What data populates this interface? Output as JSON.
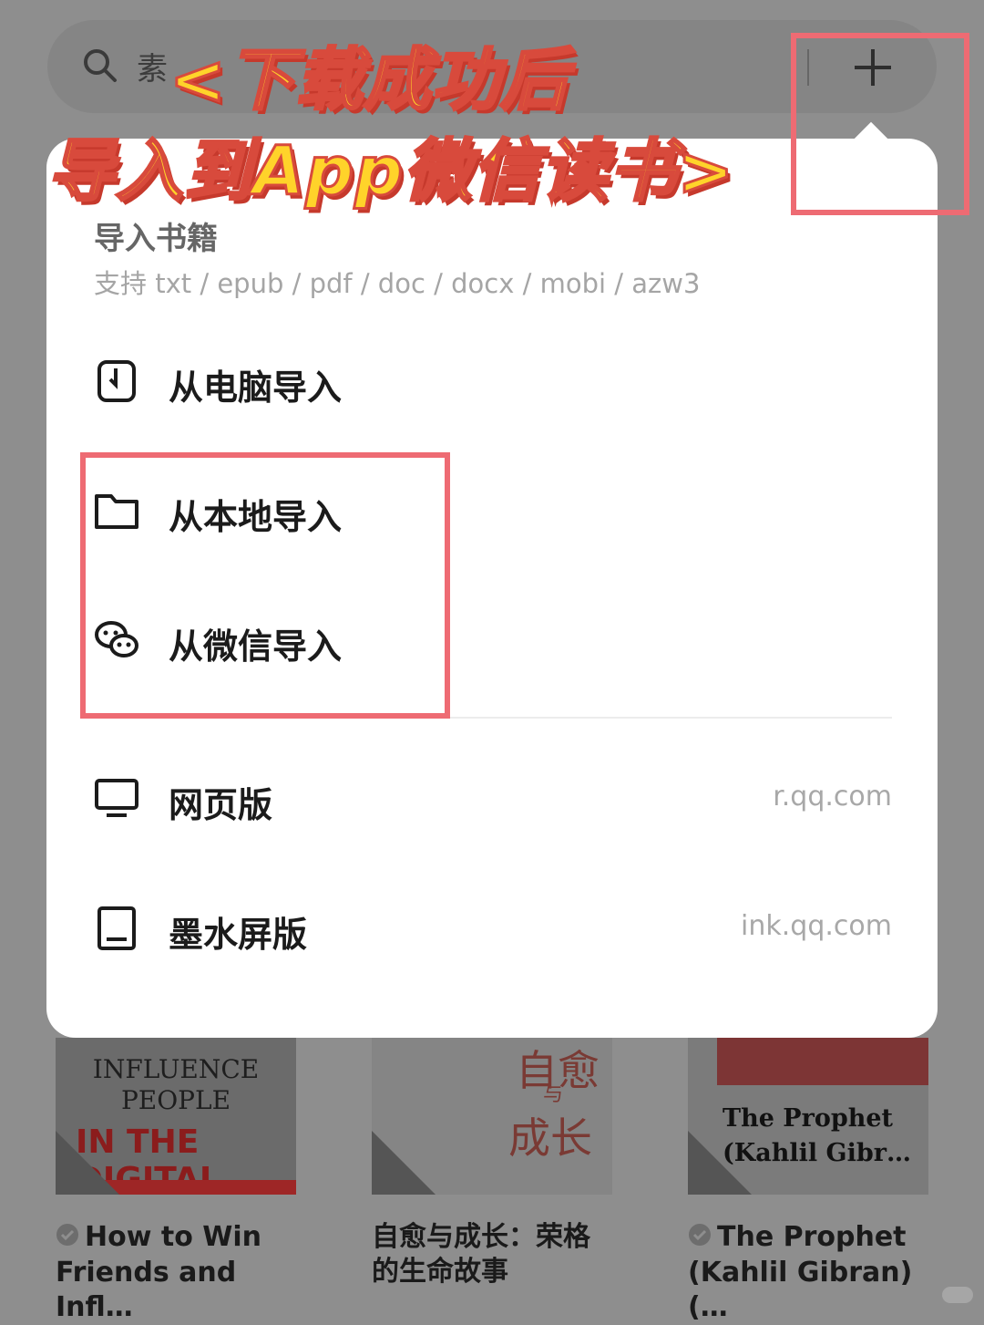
{
  "search": {
    "text": "素"
  },
  "banner": {
    "line1": "<下载成功后",
    "line2": "导入到App微信读书>"
  },
  "popup": {
    "title": "导入书籍",
    "subtitle": "支持 txt / epub / pdf / doc / docx / mobi / azw3",
    "items": [
      {
        "label": "从电脑导入",
        "icon": "phone-link-icon",
        "url": ""
      },
      {
        "label": "从本地导入",
        "icon": "folder-icon",
        "url": ""
      },
      {
        "label": "从微信导入",
        "icon": "wechat-icon",
        "url": ""
      },
      {
        "label": "网页版",
        "icon": "monitor-icon",
        "url": "r.qq.com"
      },
      {
        "label": "墨水屏版",
        "icon": "tablet-icon",
        "url": "ink.qq.com"
      }
    ]
  },
  "books": [
    {
      "title": "How to Win Friends and Infl…",
      "cover": {
        "line1": "INFLUENCE",
        "line2": "PEOPLE",
        "line3": "IN THE DIGITAL AGE"
      }
    },
    {
      "title": "自愈与成长：荣格的生命故事",
      "cover": {
        "line1": "自愈",
        "line2": "与",
        "line3": "成长"
      }
    },
    {
      "title": "The Prophet (Kahlil Gibran) (…",
      "cover": {
        "line1": "The Prophet (Kahlil Gibr…"
      }
    }
  ],
  "colors": {
    "highlight": "#ee6b73",
    "banner_fill": "#ffd32a",
    "banner_stroke": "#d84a3c"
  }
}
